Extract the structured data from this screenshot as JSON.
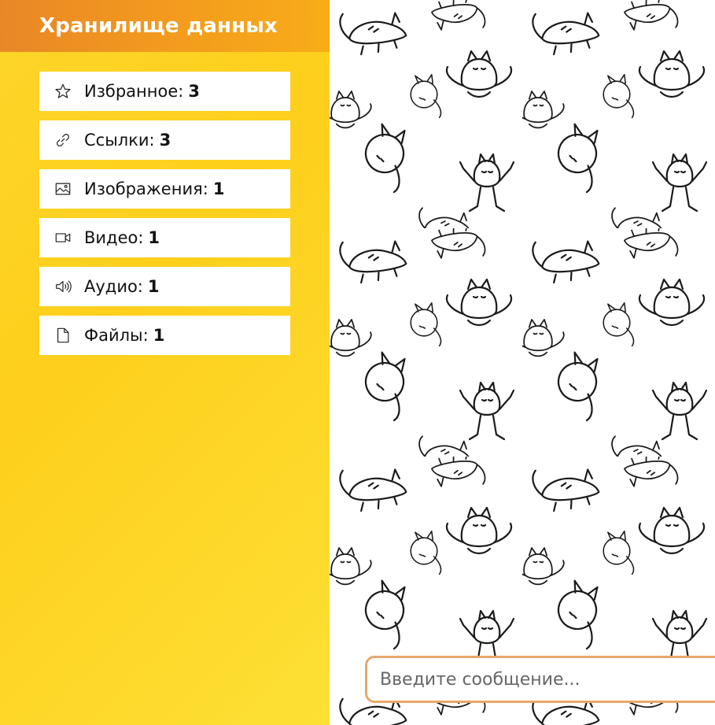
{
  "sidebar": {
    "title": "Хранилище данных",
    "items": [
      {
        "label": "Избранное:",
        "count": "3",
        "icon": "star-icon"
      },
      {
        "label": "Ссылки:",
        "count": "3",
        "icon": "link-icon"
      },
      {
        "label": "Изображения:",
        "count": "1",
        "icon": "image-icon"
      },
      {
        "label": "Видео:",
        "count": "1",
        "icon": "video-icon"
      },
      {
        "label": "Аудио:",
        "count": "1",
        "icon": "audio-icon"
      },
      {
        "label": "Файлы:",
        "count": "1",
        "icon": "file-icon"
      }
    ]
  },
  "chat": {
    "background": "cat-doodle-pattern",
    "input_placeholder": "Введите сообщение..."
  },
  "colors": {
    "header_orange": "#ef8f22",
    "sidebar_yellow": "#fdd62a",
    "input_border": "#e8a769"
  }
}
